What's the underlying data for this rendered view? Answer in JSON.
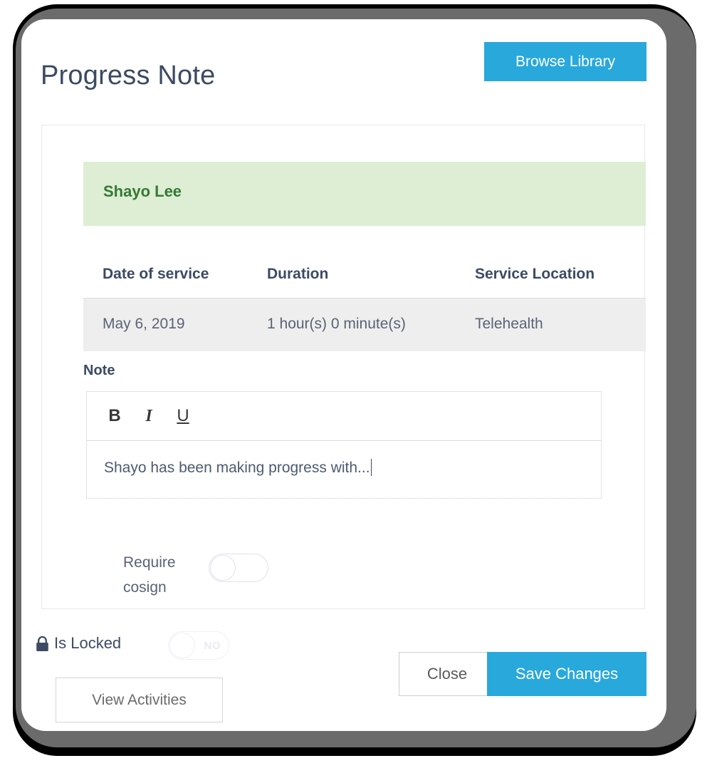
{
  "window": {
    "title": "Progress Note"
  },
  "header": {
    "title": "Progress Note",
    "browse_library_label": "Browse Library"
  },
  "client": {
    "name": "Shayo Lee"
  },
  "service_table": {
    "columns": [
      "Date of service",
      "Duration",
      "Service Location"
    ],
    "rows": [
      {
        "date_of_service": "May 6, 2019",
        "duration": "1 hour(s) 0 minute(s)",
        "service_location": "Telehealth"
      }
    ]
  },
  "note": {
    "label": "Note",
    "toolbar": {
      "bold": "B",
      "italic": "I",
      "underline": "U"
    },
    "value": "Shayo has been making progress with..."
  },
  "cosign": {
    "label": "Require cosign",
    "enabled": false
  },
  "locked": {
    "label": "Is Locked",
    "toggle_value": "NO",
    "enabled": false
  },
  "footer": {
    "view_activities_label": "View Activities",
    "close_label": "Close",
    "save_label": "Save Changes"
  },
  "colors": {
    "accent_blue": "#29a8dc",
    "title_navy": "#3c4a63",
    "banner_green_bg": "#ddeed4",
    "banner_green_text": "#357935",
    "frame_gray": "#6b6b6b"
  }
}
